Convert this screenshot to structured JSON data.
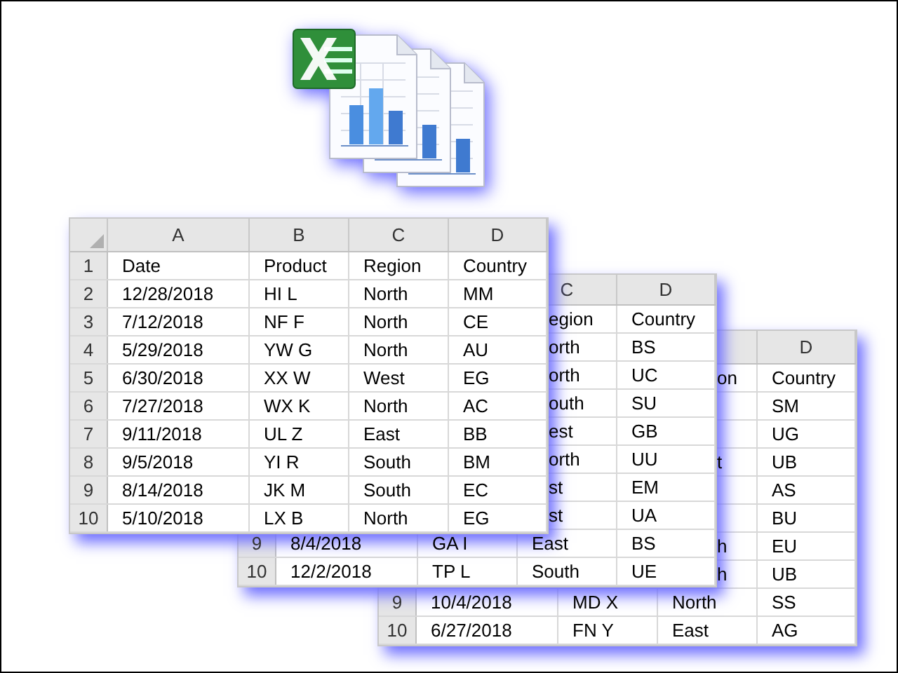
{
  "sheets": [
    {
      "columns": [
        null,
        null,
        null,
        "D"
      ],
      "rows": [
        {
          "number": null,
          "cells": [
            null,
            null,
            {
              "text": "on",
              "cut": true
            },
            {
              "text": "Country"
            }
          ]
        },
        {
          "number": null,
          "cells": [
            null,
            null,
            null,
            {
              "text": "SM"
            }
          ]
        },
        {
          "number": null,
          "cells": [
            null,
            null,
            null,
            {
              "text": "UG"
            }
          ]
        },
        {
          "number": null,
          "cells": [
            null,
            null,
            {
              "text": "t",
              "cut": true
            },
            {
              "text": "UB"
            }
          ]
        },
        {
          "number": null,
          "cells": [
            null,
            null,
            null,
            {
              "text": "AS"
            }
          ]
        },
        {
          "number": null,
          "cells": [
            null,
            null,
            null,
            {
              "text": "BU"
            }
          ]
        },
        {
          "number": null,
          "cells": [
            null,
            null,
            {
              "text": "h",
              "cut": true
            },
            {
              "text": "EU"
            }
          ]
        },
        {
          "number": null,
          "cells": [
            null,
            null,
            {
              "text": "h",
              "cut": true
            },
            {
              "text": "UB"
            }
          ]
        },
        {
          "number": "9",
          "cells": [
            {
              "text": "10/4/2018"
            },
            {
              "text": "MD X"
            },
            {
              "text": "North"
            },
            {
              "text": "SS"
            }
          ]
        },
        {
          "number": "10",
          "cells": [
            {
              "text": "6/27/2018"
            },
            {
              "text": "FN Y"
            },
            {
              "text": "East"
            },
            {
              "text": "AG"
            }
          ]
        }
      ]
    },
    {
      "columns": [
        null,
        null,
        "C",
        "D"
      ],
      "rows": [
        {
          "number": null,
          "cells": [
            null,
            null,
            {
              "text": "egion",
              "cut": true
            },
            {
              "text": "Country"
            }
          ]
        },
        {
          "number": null,
          "cells": [
            null,
            null,
            {
              "text": "orth",
              "cut": true
            },
            {
              "text": "BS"
            }
          ]
        },
        {
          "number": null,
          "cells": [
            null,
            null,
            {
              "text": "orth",
              "cut": true
            },
            {
              "text": "UC"
            }
          ]
        },
        {
          "number": null,
          "cells": [
            null,
            null,
            {
              "text": "outh",
              "cut": true
            },
            {
              "text": "SU"
            }
          ]
        },
        {
          "number": null,
          "cells": [
            null,
            null,
            {
              "text": "est",
              "cut": true
            },
            {
              "text": "GB"
            }
          ]
        },
        {
          "number": null,
          "cells": [
            null,
            null,
            {
              "text": "orth",
              "cut": true
            },
            {
              "text": "UU"
            }
          ]
        },
        {
          "number": null,
          "cells": [
            null,
            null,
            {
              "text": "st",
              "cut": true
            },
            {
              "text": "EM"
            }
          ]
        },
        {
          "number": null,
          "cells": [
            null,
            null,
            {
              "text": "st",
              "cut": true
            },
            {
              "text": "UA"
            }
          ]
        },
        {
          "number": "9",
          "cells": [
            {
              "text": "8/4/2018"
            },
            {
              "text": "GA I"
            },
            {
              "text": "East"
            },
            {
              "text": "BS"
            }
          ]
        },
        {
          "number": "10",
          "cells": [
            {
              "text": "12/2/2018"
            },
            {
              "text": "TP L"
            },
            {
              "text": "South"
            },
            {
              "text": "UE"
            }
          ]
        }
      ]
    },
    {
      "columns": [
        "A",
        "B",
        "C",
        "D"
      ],
      "rows": [
        {
          "number": "1",
          "cells": [
            {
              "text": "Date"
            },
            {
              "text": "Product"
            },
            {
              "text": "Region"
            },
            {
              "text": "Country"
            }
          ]
        },
        {
          "number": "2",
          "cells": [
            {
              "text": "12/28/2018"
            },
            {
              "text": "HI L"
            },
            {
              "text": "North"
            },
            {
              "text": "MM"
            }
          ]
        },
        {
          "number": "3",
          "cells": [
            {
              "text": "7/12/2018"
            },
            {
              "text": "NF F"
            },
            {
              "text": "North"
            },
            {
              "text": "CE"
            }
          ]
        },
        {
          "number": "4",
          "cells": [
            {
              "text": "5/29/2018"
            },
            {
              "text": "YW G"
            },
            {
              "text": "North"
            },
            {
              "text": "AU"
            }
          ]
        },
        {
          "number": "5",
          "cells": [
            {
              "text": "6/30/2018"
            },
            {
              "text": "XX W"
            },
            {
              "text": "West"
            },
            {
              "text": "EG"
            }
          ]
        },
        {
          "number": "6",
          "cells": [
            {
              "text": "7/27/2018"
            },
            {
              "text": "WX K"
            },
            {
              "text": "North"
            },
            {
              "text": "AC"
            }
          ]
        },
        {
          "number": "7",
          "cells": [
            {
              "text": "9/11/2018"
            },
            {
              "text": "UL Z"
            },
            {
              "text": "East"
            },
            {
              "text": "BB"
            }
          ]
        },
        {
          "number": "8",
          "cells": [
            {
              "text": "9/5/2018"
            },
            {
              "text": "YI R"
            },
            {
              "text": "South"
            },
            {
              "text": "BM"
            }
          ]
        },
        {
          "number": "9",
          "cells": [
            {
              "text": "8/14/2018"
            },
            {
              "text": "JK M"
            },
            {
              "text": "South"
            },
            {
              "text": "EC"
            }
          ]
        },
        {
          "number": "10",
          "cells": [
            {
              "text": "5/10/2018"
            },
            {
              "text": "LX B"
            },
            {
              "text": "North"
            },
            {
              "text": "EG"
            }
          ]
        }
      ]
    }
  ]
}
